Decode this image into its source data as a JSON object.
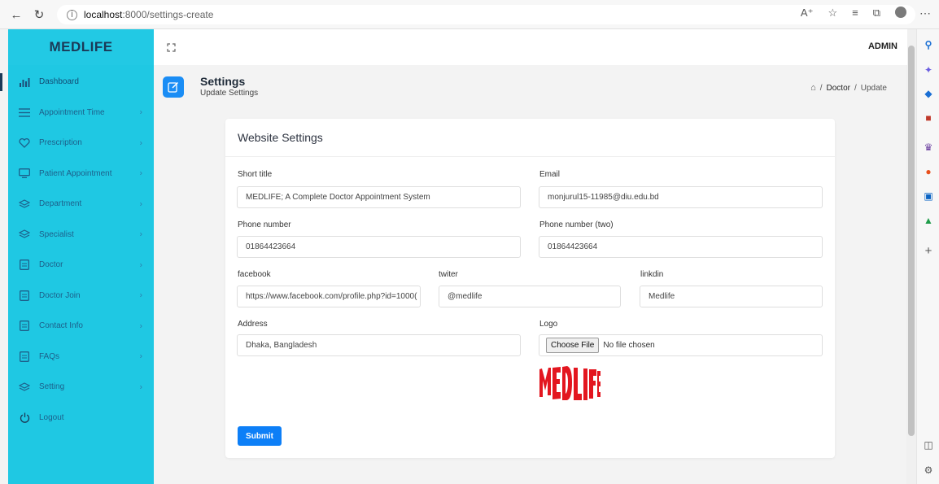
{
  "browser": {
    "url_host": "localhost",
    "url_path": ":8000/settings-create"
  },
  "sidebar": {
    "brand": "MEDLIFE",
    "items": [
      {
        "label": "Dashboard",
        "icon": "bar-chart-icon"
      },
      {
        "label": "Appointment Time",
        "icon": "list-icon"
      },
      {
        "label": "Prescription",
        "icon": "heart-icon"
      },
      {
        "label": "Patient Appointment",
        "icon": "monitor-icon"
      },
      {
        "label": "Department",
        "icon": "layers-icon"
      },
      {
        "label": "Specialist",
        "icon": "layers-icon"
      },
      {
        "label": "Doctor",
        "icon": "file-icon"
      },
      {
        "label": "Doctor Join",
        "icon": "file-icon"
      },
      {
        "label": "Contact Info",
        "icon": "file-icon"
      },
      {
        "label": "FAQs",
        "icon": "file-icon"
      },
      {
        "label": "Setting",
        "icon": "layers-icon"
      },
      {
        "label": "Logout",
        "icon": "power-icon"
      }
    ]
  },
  "topbar": {
    "user": "ADMIN"
  },
  "page_header": {
    "title": "Settings",
    "subtitle": "Update Settings"
  },
  "breadcrumb": {
    "separator": "/",
    "parent": "Doctor",
    "current": "Update"
  },
  "form": {
    "card_title": "Website Settings",
    "short_title_label": "Short title",
    "short_title_value": "MEDLIFE; A Complete Doctor Appointment System",
    "email_label": "Email",
    "email_value": "monjurul15-11985@diu.edu.bd",
    "phone_label": "Phone number",
    "phone_value": "01864423664",
    "phone2_label": "Phone number (two)",
    "phone2_value": "01864423664",
    "facebook_label": "facebook",
    "facebook_value": "https://www.facebook.com/profile.php?id=1000(",
    "twitter_label": "twiter",
    "twitter_value": "@medlife",
    "linkedin_label": "linkdin",
    "linkedin_value": "Medlife",
    "address_label": "Address",
    "address_value": "Dhaka, Bangladesh",
    "logo_label": "Logo",
    "file_button": "Choose File",
    "file_status": "No file chosen",
    "submit_label": "Submit"
  },
  "colors": {
    "sidebar_bg": "#1fc8e3",
    "primary": "#0d7ff7",
    "logo_red": "#e3161f"
  }
}
